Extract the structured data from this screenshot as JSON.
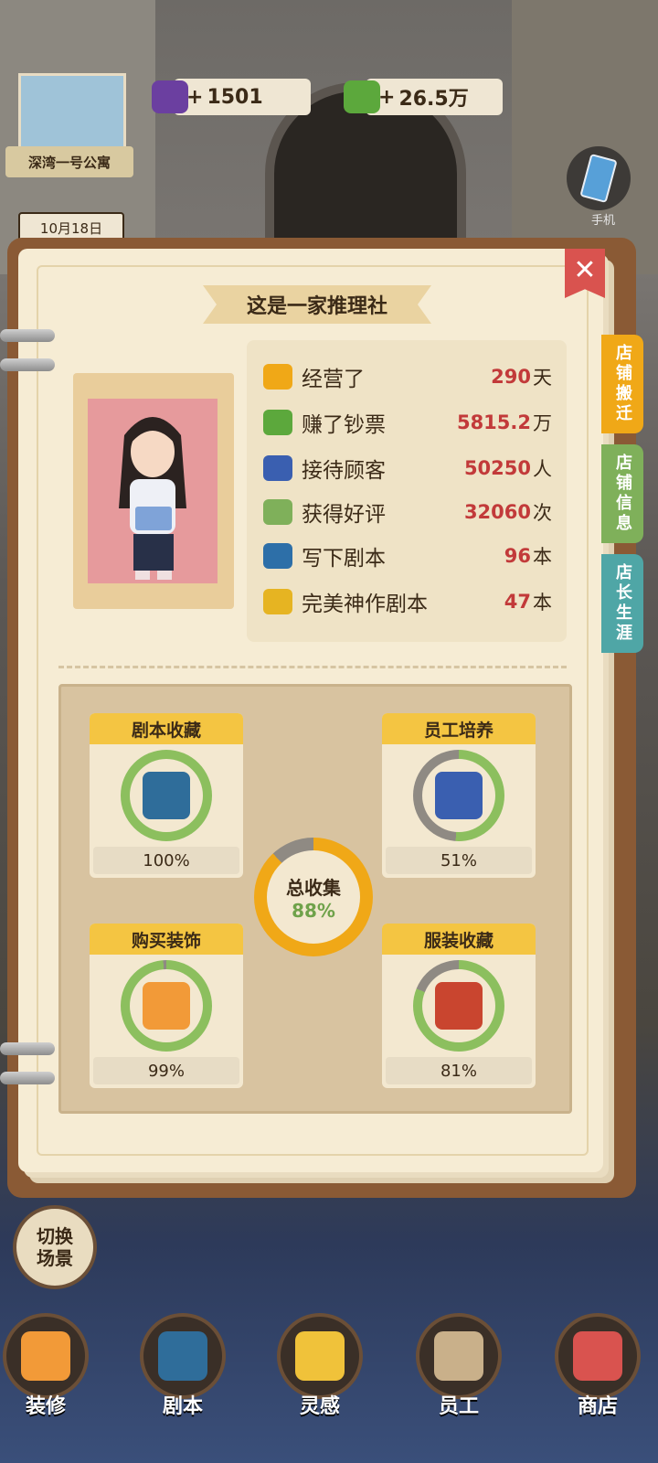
{
  "resources": {
    "gems": "1501",
    "cash": "26.5万",
    "plus": "+"
  },
  "apartment": {
    "label": "深湾一号公寓"
  },
  "date": "10月18日",
  "phone": {
    "label": "手机"
  },
  "panel": {
    "title": "这是一家推理社",
    "close": "✕",
    "tabs": [
      "店铺搬迁",
      "店铺信息",
      "店长生涯"
    ]
  },
  "stats": [
    {
      "icon": "house-icon",
      "label": "经营了",
      "value": "290",
      "unit": "天"
    },
    {
      "icon": "cash-icon",
      "label": "赚了钞票",
      "value": "5815.2",
      "unit": "万"
    },
    {
      "icon": "customers-icon",
      "label": "接待顾客",
      "value": "50250",
      "unit": "人"
    },
    {
      "icon": "thumbs-up-icon",
      "label": "获得好评",
      "value": "32060",
      "unit": "次"
    },
    {
      "icon": "script-book-icon",
      "label": "写下剧本",
      "value": "96",
      "unit": "本"
    },
    {
      "icon": "gold-script-icon",
      "label": "完美神作剧本",
      "value": "47",
      "unit": "本"
    }
  ],
  "collections": [
    {
      "title": "剧本收藏",
      "percent_label": "100%",
      "progress": 1.0,
      "icon": "script-book-icon"
    },
    {
      "title": "员工培养",
      "percent_label": "51%",
      "progress": 0.51,
      "icon": "staff-icon"
    },
    {
      "title": "购买装饰",
      "percent_label": "99%",
      "progress": 0.99,
      "icon": "shop-house-icon"
    },
    {
      "title": "服装收藏",
      "percent_label": "81%",
      "progress": 0.81,
      "icon": "mystery-shirt-icon"
    }
  ],
  "total": {
    "title": "总收集",
    "percent_label": "88%",
    "progress": 0.88
  },
  "switch_scene": "切换场景",
  "nav": [
    "装修",
    "剧本",
    "灵感",
    "员工",
    "商店"
  ],
  "colors": {
    "ring_green": "#8cbf5e",
    "ring_gray": "#8f8a83",
    "total_orange": "#f0a817",
    "value_red": "#c23a3a",
    "tab_orange": "#f0a817",
    "tab_green": "#7fb05a",
    "tab_teal": "#4fa6a6"
  }
}
